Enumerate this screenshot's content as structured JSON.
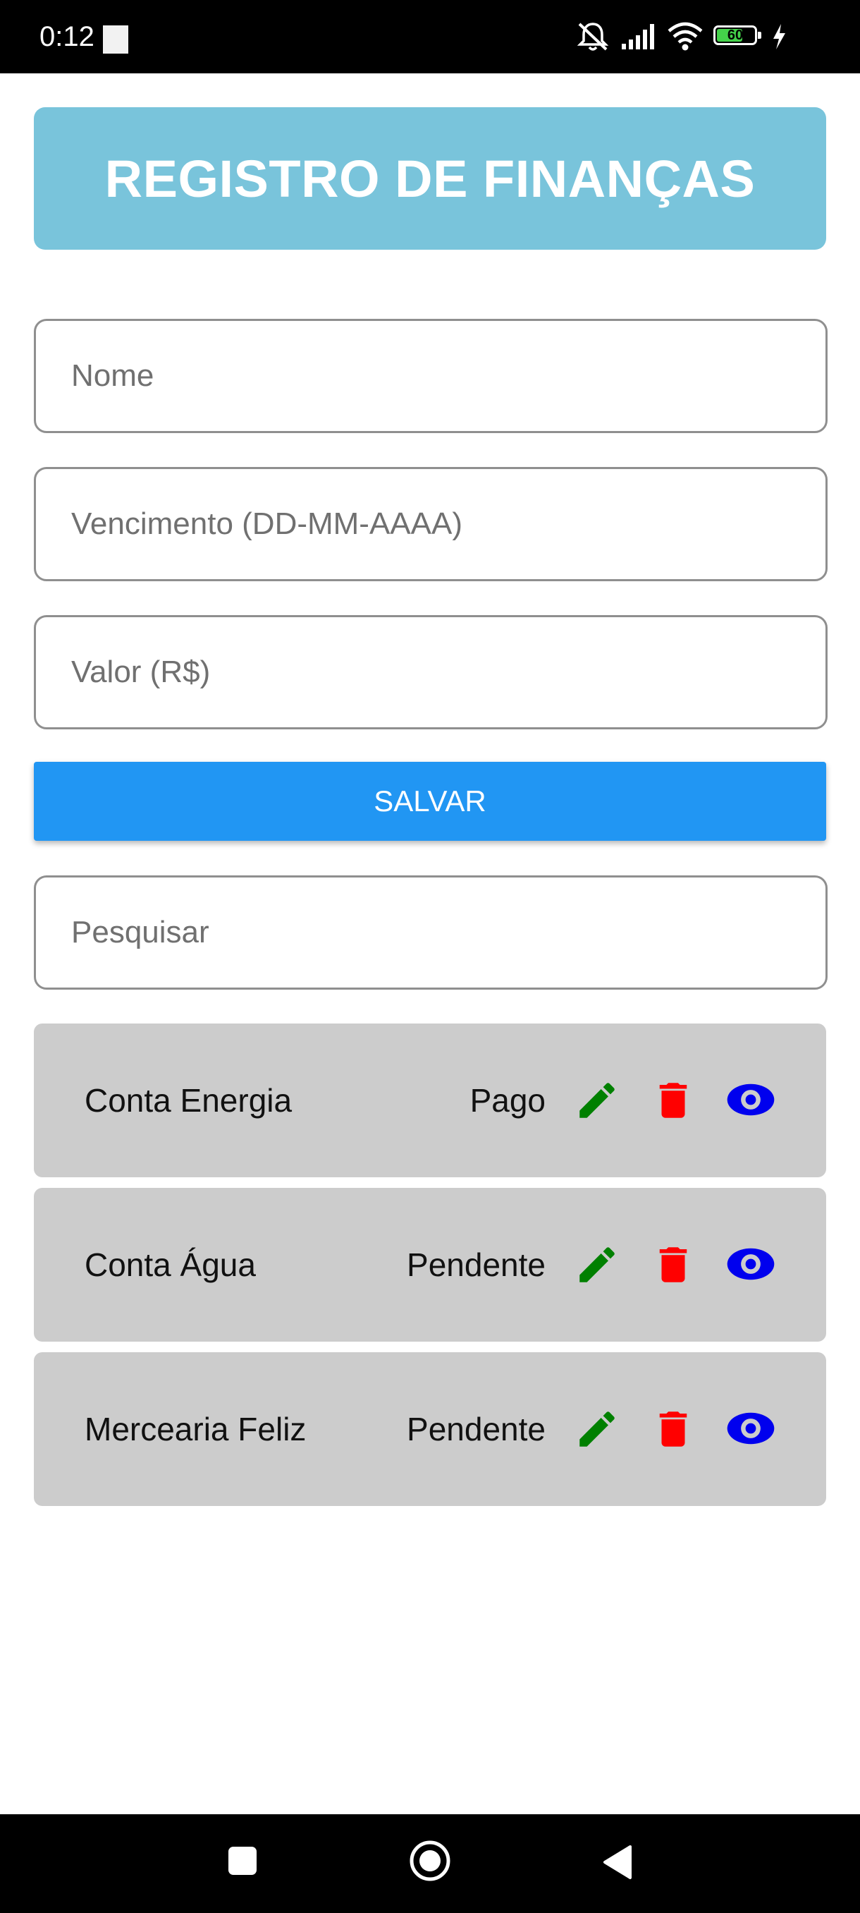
{
  "status_bar": {
    "time": "0:12",
    "battery": "60",
    "icons": [
      "mute-icon",
      "signal-icon",
      "wifi-icon",
      "battery-icon",
      "charging-icon"
    ]
  },
  "header": {
    "title": "REGISTRO DE FINANÇAS"
  },
  "form": {
    "name_placeholder": "Nome",
    "name_value": "",
    "due_placeholder": "Vencimento (DD-MM-AAAA)",
    "due_value": "",
    "amount_placeholder": "Valor (R$)",
    "amount_value": "",
    "save_label": "SALVAR"
  },
  "search": {
    "placeholder": "Pesquisar",
    "value": ""
  },
  "entries": [
    {
      "name": "Conta Energia",
      "status": "Pago"
    },
    {
      "name": "Conta Água",
      "status": "Pendente"
    },
    {
      "name": "Mercearia Feliz",
      "status": "Pendente"
    }
  ],
  "colors": {
    "header": "#79c4db",
    "save_button": "#2196f3",
    "list_item": "#cccccc",
    "edit_icon": "#008000",
    "delete_icon": "#ff0000",
    "view_icon": "#0000ee"
  },
  "nav_bar": [
    "recents-button",
    "home-button",
    "back-button"
  ]
}
